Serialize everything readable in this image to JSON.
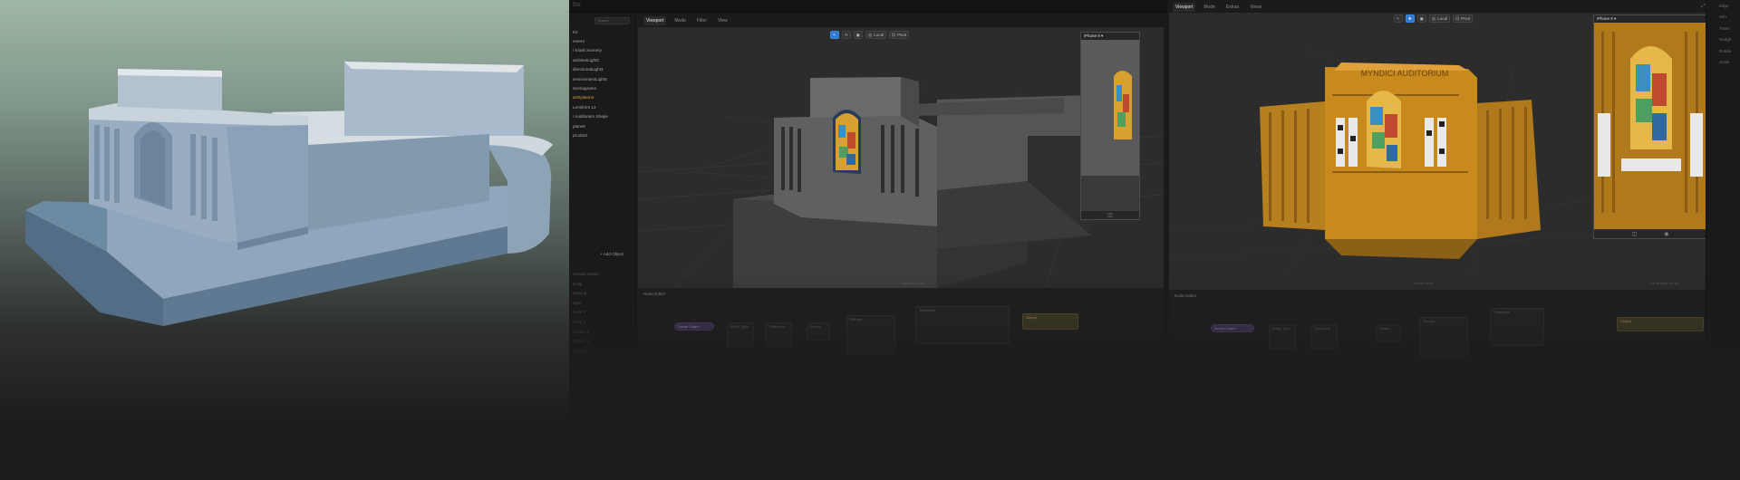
{
  "left_window": {
    "title_glyph": "Dis",
    "tabs": [
      "Viewport",
      "Mode",
      "Filter",
      "View"
    ],
    "search_placeholder": "Search",
    "outliner": [
      {
        "label": "Kit",
        "highlight": false
      },
      {
        "label": "emero",
        "highlight": false
      },
      {
        "label": "/ Kiosk Scenery",
        "highlight": false
      },
      {
        "label": "ambientLight3",
        "highlight": false
      },
      {
        "label": "directionalLight3",
        "highlight": false
      },
      {
        "label": "environmentLight5",
        "highlight": false
      },
      {
        "label": "Scenagrams",
        "highlight": false
      },
      {
        "label": "artSystem4",
        "highlight": true
      },
      {
        "label": "Lensform 12",
        "highlight": false
      },
      {
        "label": "/ Auditorium Shape",
        "highlight": false
      },
      {
        "label": "plane6",
        "highlight": false
      },
      {
        "label": "pCube2",
        "highlight": false
      }
    ],
    "add_object_label": "+ Add Object",
    "properties": [
      "Version Shape",
      "sculp",
      "spacing",
      "layer",
      "scale Y",
      "scale Z",
      "rotation Z",
      "rotation X",
      "shadows"
    ],
    "toolbar": {
      "local_label": "Local",
      "pivot_label": "Pivot"
    },
    "preview_title": "iPhone 8  ▾",
    "viewport_caption": "Viewport Mode",
    "node_editor_title": "Node Editor",
    "nodes": [
      "Scene Graph",
      "Entity Type",
      "Transform",
      "Shape",
      "Render",
      "Transform",
      "Output"
    ]
  },
  "right_window": {
    "tabs": [
      "Viewport",
      "Mode",
      "Extras",
      "Views"
    ],
    "toolbar": {
      "local_label": "Local",
      "pivot_label": "Pivot"
    },
    "preview_title": "iPhone 8  ▾",
    "building_sign": "MYNDICI  AUDITORIUM",
    "viewport_caption": "Kinect Feed",
    "status_right": "Env quality: 60 fps",
    "node_editor_title": "Node Editor",
    "nodes": [
      "Scene Graph",
      "Entity Type",
      "Transform",
      "Shape",
      "Render",
      "Transform",
      "Output"
    ]
  },
  "side_strip": [
    "Edge",
    "Sim",
    "Trans",
    "Nudge",
    "Rotate",
    "Scale"
  ],
  "colors": {
    "selection_blue": "#2d7ad0",
    "outliner_highlight": "#d9a441",
    "point_cloud_gold": "#c8891d"
  }
}
